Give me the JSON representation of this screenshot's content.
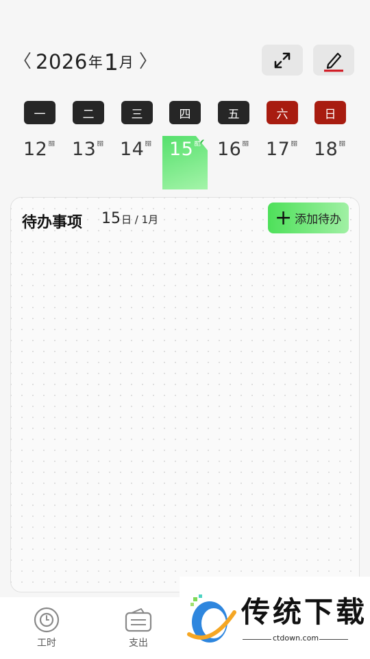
{
  "header": {
    "prev_label": "〈",
    "year": "2026",
    "year_unit": "年",
    "month": "1",
    "month_unit": "月",
    "next_label": "〉"
  },
  "weekdays": [
    "一",
    "二",
    "三",
    "四",
    "五",
    "六",
    "日"
  ],
  "dates": [
    {
      "day": "12",
      "lunar": "腊"
    },
    {
      "day": "13",
      "lunar": "腊"
    },
    {
      "day": "14",
      "lunar": "腊"
    },
    {
      "day": "15",
      "lunar": "腊"
    },
    {
      "day": "16",
      "lunar": "腊"
    },
    {
      "day": "17",
      "lunar": "腊"
    },
    {
      "day": "18",
      "lunar": "腊"
    }
  ],
  "selected_check": "✔",
  "todo": {
    "title": "待办事项",
    "date_day": "15",
    "date_suffix": "日 / 1月",
    "add_plus": "+",
    "add_label": "添加待办"
  },
  "nav": [
    {
      "label": "工时"
    },
    {
      "label": "支出"
    }
  ],
  "watermark": {
    "text": "传统下载",
    "url": "ctdown.com"
  },
  "colors": {
    "weekend": "#a81c10",
    "accent_green": "#4ee05a",
    "edit_underline": "#d0121b"
  }
}
